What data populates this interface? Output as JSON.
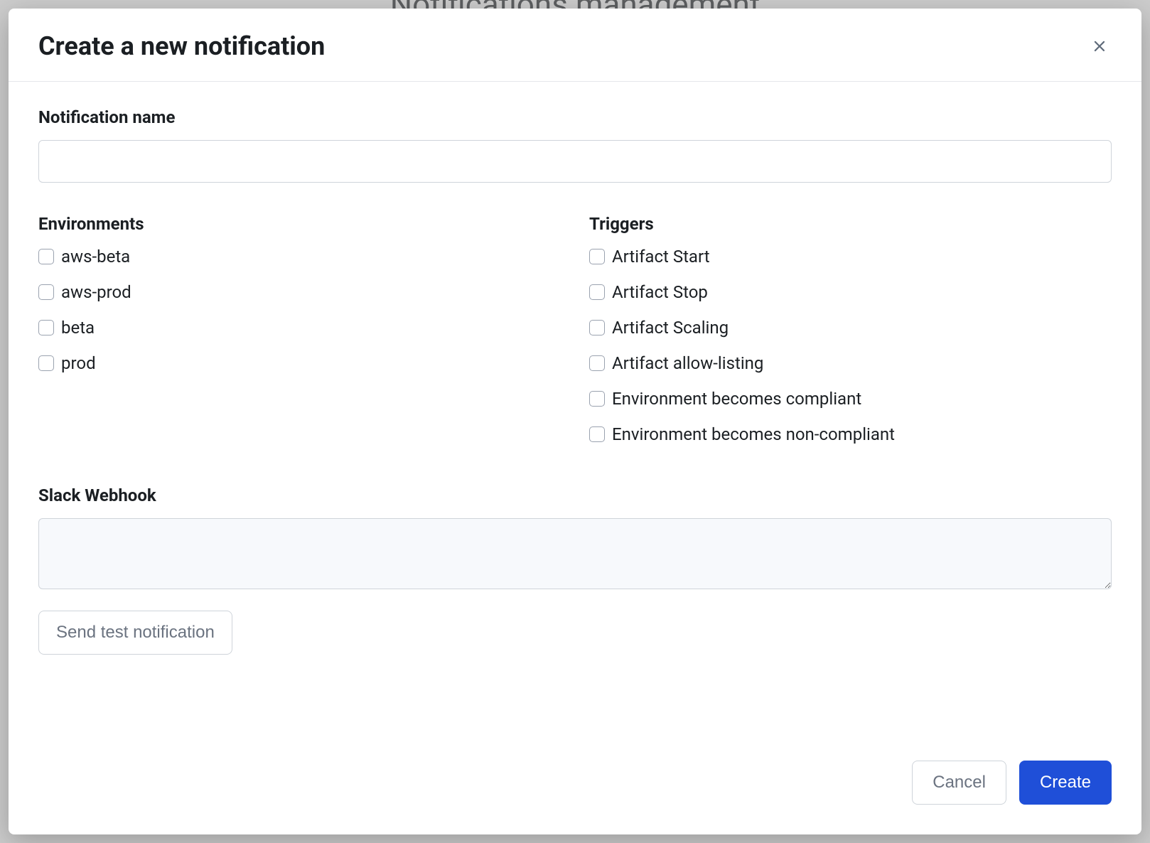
{
  "backdrop": {
    "page_title": "Notifications management"
  },
  "modal": {
    "title": "Create a new notification",
    "name_field": {
      "label": "Notification name",
      "value": ""
    },
    "environments": {
      "label": "Environments",
      "items": [
        {
          "label": "aws-beta",
          "checked": false
        },
        {
          "label": "aws-prod",
          "checked": false
        },
        {
          "label": "beta",
          "checked": false
        },
        {
          "label": "prod",
          "checked": false
        }
      ]
    },
    "triggers": {
      "label": "Triggers",
      "items": [
        {
          "label": "Artifact Start",
          "checked": false
        },
        {
          "label": "Artifact Stop",
          "checked": false
        },
        {
          "label": "Artifact Scaling",
          "checked": false
        },
        {
          "label": "Artifact allow-listing",
          "checked": false
        },
        {
          "label": "Environment becomes compliant",
          "checked": false
        },
        {
          "label": "Environment becomes non-compliant",
          "checked": false
        }
      ]
    },
    "webhook": {
      "label": "Slack Webhook",
      "value": ""
    },
    "buttons": {
      "send_test": "Send test notification",
      "cancel": "Cancel",
      "create": "Create"
    }
  }
}
